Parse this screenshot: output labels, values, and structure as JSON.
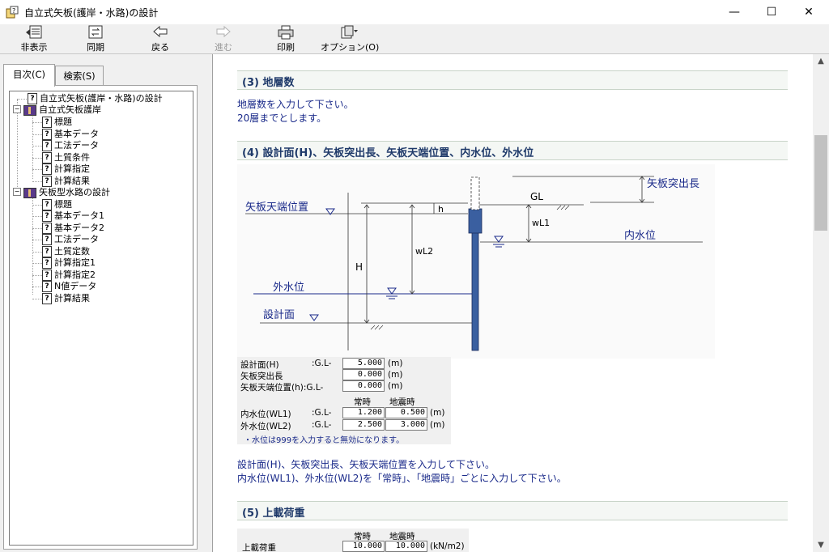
{
  "window": {
    "title": "自立式矢板(護岸・水路)の設計",
    "minimize": "—",
    "maximize": "☐",
    "close": "✕"
  },
  "toolbar": {
    "hide": "非表示",
    "sync": "同期",
    "back": "戻る",
    "forward": "進む",
    "print": "印刷",
    "options": "オプション(O)"
  },
  "tabs": {
    "contents": "目次(C)",
    "search": "検索(S)"
  },
  "tree": {
    "root": "自立式矢板(護岸・水路)の設計",
    "group1": {
      "label": "自立式矢板護岸",
      "items": [
        "標題",
        "基本データ",
        "工法データ",
        "土質条件",
        "計算指定",
        "計算結果"
      ]
    },
    "group2": {
      "label": "矢板型水路の設計",
      "items": [
        "標題",
        "基本データ1",
        "基本データ2",
        "工法データ",
        "土質定数",
        "計算指定1",
        "計算指定2",
        "N値データ",
        "計算結果"
      ]
    }
  },
  "content": {
    "sec3": {
      "title": "(3) 地層数",
      "line1": "地層数を入力して下さい。",
      "line2": "20層までとします。"
    },
    "sec4": {
      "title": "(4) 設計面(H)、矢板突出長、矢板天端位置、内水位、外水位",
      "diagram": {
        "pile_protrusion": "矢板突出長",
        "gl": "GL",
        "top_pos": "矢板天端位置",
        "h_small": "h",
        "wl1": "wL1",
        "inner_water": "内水位",
        "wl2": "wL2",
        "H": "H",
        "outer_water": "外水位",
        "design_surface": "設計面"
      },
      "form": {
        "row1": "設計面(H)",
        "row1b": ":G.L-",
        "row1v": "5.000",
        "row1u": "(m)",
        "row2": "矢板突出長",
        "row2v": "0.000",
        "row2u": "(m)",
        "row3": "矢板天端位置(h):G.L-",
        "row3v": "0.000",
        "row3u": "(m)",
        "col1": "常時",
        "col2": "地震時",
        "row4": "内水位(WL1)",
        "row4b": ":G.L-",
        "row4v1": "1.200",
        "row4v2": "0.500",
        "row4u": "(m)",
        "row5": "外水位(WL2)",
        "row5b": ":G.L-",
        "row5v1": "2.500",
        "row5v2": "3.000",
        "row5u": "(m)",
        "note": "・水位は999を入力すると無効になります。"
      },
      "line1": "設計面(H)、矢板突出長、矢板天端位置を入力して下さい。",
      "line2": "内水位(WL1)、外水位(WL2)を「常時」、「地震時」ごとに入力して下さい。"
    },
    "sec5": {
      "title": "(5) 上載荷重",
      "form": {
        "col1": "常時",
        "col2": "地震時",
        "row1": "上載荷重",
        "v1": "10.000",
        "v2": "10.000",
        "unit": "(kN/m2)"
      }
    }
  },
  "colors": {
    "heading": "#1f3a6a",
    "body_text": "#1a2a8a",
    "pile": "#3a5fa0",
    "water": "#1a2a8a"
  }
}
